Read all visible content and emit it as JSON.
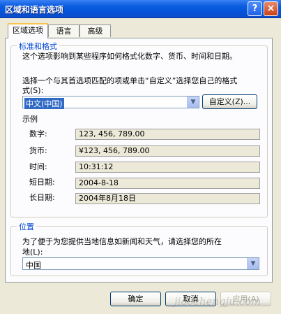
{
  "window": {
    "title": "区域和语言选项",
    "help_glyph": "?",
    "close_glyph": "×"
  },
  "tabs": [
    {
      "label": "区域选项",
      "active": true
    },
    {
      "label": "语言",
      "active": false
    },
    {
      "label": "高级",
      "active": false
    }
  ],
  "standards": {
    "group_title": "标准和格式",
    "description": "这个选项影响到某些程序如何格式化数字、货币、时间和日期。",
    "instruction_line1": "选择一个与其首选项匹配的项或单击“自定义”选择您自己的格式",
    "instruction_line2": "式(S):",
    "locale_value": "中文(中国)",
    "customize_label": "自定义(Z)...",
    "samples_heading": "示例",
    "samples": [
      {
        "label": "数字:",
        "value": "123, 456, 789.00"
      },
      {
        "label": "货币:",
        "value": "¥123, 456, 789.00"
      },
      {
        "label": "时间:",
        "value": "10:31:12"
      },
      {
        "label": "短日期:",
        "value": "2004-8-18"
      },
      {
        "label": "长日期:",
        "value": "2004年8月18日"
      }
    ]
  },
  "location": {
    "group_title": "位置",
    "description_line1": "为了便于为您提供当地信息如新闻和天气，请选择您的所在",
    "description_line2": "地(L):",
    "value": "中国"
  },
  "buttons": {
    "ok": "确定",
    "cancel": "取消",
    "apply": "应用(A)"
  },
  "icons": {
    "dropdown": "chevron-down-icon"
  },
  "colors": {
    "titlebar": "#0A5DE0",
    "dialog_bg": "#ECE9D8",
    "group_title": "#0046D5",
    "selection": "#316AC5"
  },
  "watermark": "jiaochengju.com"
}
